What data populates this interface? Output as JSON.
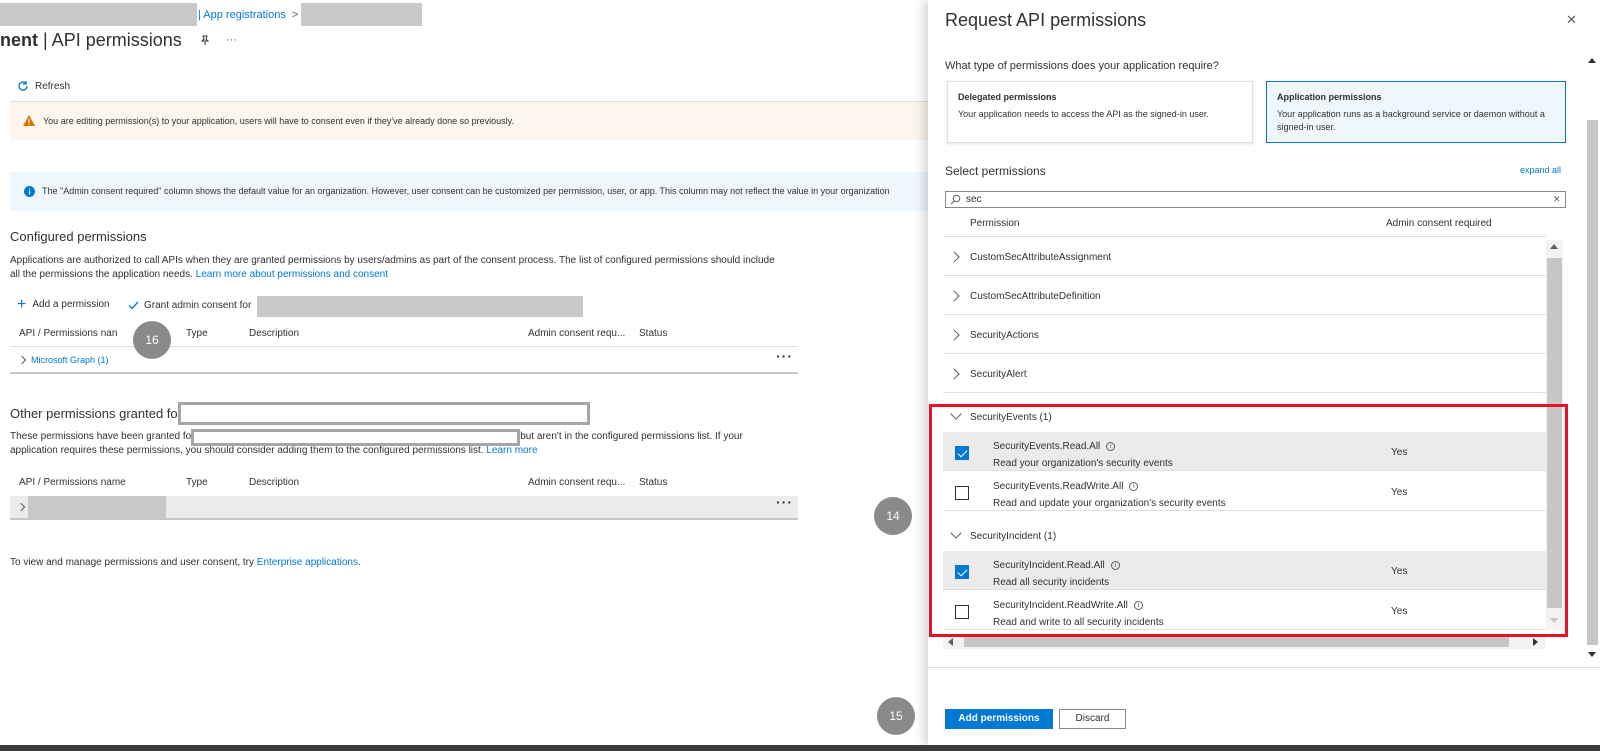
{
  "breadcrumb": {
    "item": "| App registrations",
    "sep": ">"
  },
  "page": {
    "title_bold": "nent",
    "title_rest": " | API permissions",
    "pin_icon": "pin-icon",
    "more": "···"
  },
  "toolbar": {
    "refresh": "Refresh"
  },
  "warning": {
    "text": "You are editing permission(s) to your application, users will have to consent even if they've already done so previously."
  },
  "info": {
    "text": "The \"Admin consent required\" column shows the default value for an organization. However, user consent can be customized per permission, user, or app. This column may not reflect the value in your organization"
  },
  "configured": {
    "title": "Configured permissions",
    "desc1": "Applications are authorized to call APIs when they are granted permissions by users/admins as part of the consent process. The list of configured permissions should include",
    "desc2": "all the permissions the application needs.",
    "learn_link": "Learn more about permissions and consent",
    "add_permission": "Add a permission",
    "grant_consent": "Grant admin consent for",
    "columns": [
      "API / Permissions nan",
      "Type",
      "Description",
      "Admin consent requ...",
      "Status"
    ],
    "row": "Microsoft Graph (1)",
    "row_more": "···"
  },
  "other": {
    "title": "Other permissions granted for",
    "desc1a": "These permissions have been granted fo",
    "desc1b": "but aren't in the configured permissions list. If your",
    "desc2": "application requires these permissions, you should consider adding them to the configured permissions list.",
    "learn": "Learn more",
    "columns": [
      "API / Permissions name",
      "Type",
      "Description",
      "Admin consent requ...",
      "Status"
    ],
    "row_more": "···"
  },
  "footer": {
    "text": "To view and manage permissions and user consent, try",
    "link": "Enterprise applications",
    "end": "."
  },
  "badges": [
    "16",
    "14",
    "15"
  ],
  "panel": {
    "title": "Request API permissions",
    "close": "✕",
    "question": "What type of permissions does your application require?",
    "delegated": {
      "title": "Delegated permissions",
      "desc": "Your application needs to access the API as the signed-in user."
    },
    "application": {
      "title": "Application permissions",
      "desc": "Your application runs as a background service or daemon without a signed-in user."
    },
    "select_label": "Select permissions",
    "expand_all": "expand all",
    "search_value": "sec",
    "search_clear": "✕",
    "col_permission": "Permission",
    "col_admin": "Admin consent required",
    "groups_collapsed": [
      "CustomSecAttributeAssignment",
      "CustomSecAttributeDefinition",
      "SecurityActions",
      "SecurityAlert"
    ],
    "group_events": "SecurityEvents (1)",
    "group_incident": "SecurityIncident (1)",
    "perms": [
      {
        "name": "SecurityEvents.Read.All",
        "desc": "Read your organization's security events",
        "admin": "Yes",
        "checked": true
      },
      {
        "name": "SecurityEvents.ReadWrite.All",
        "desc": "Read and update your organization's security events",
        "admin": "Yes",
        "checked": false
      },
      {
        "name": "SecurityIncident.Read.All",
        "desc": "Read all security incidents",
        "admin": "Yes",
        "checked": true
      },
      {
        "name": "SecurityIncident.ReadWrite.All",
        "desc": "Read and write to all security incidents",
        "admin": "Yes",
        "checked": false
      }
    ],
    "add_button": "Add permissions",
    "discard_button": "Discard"
  }
}
